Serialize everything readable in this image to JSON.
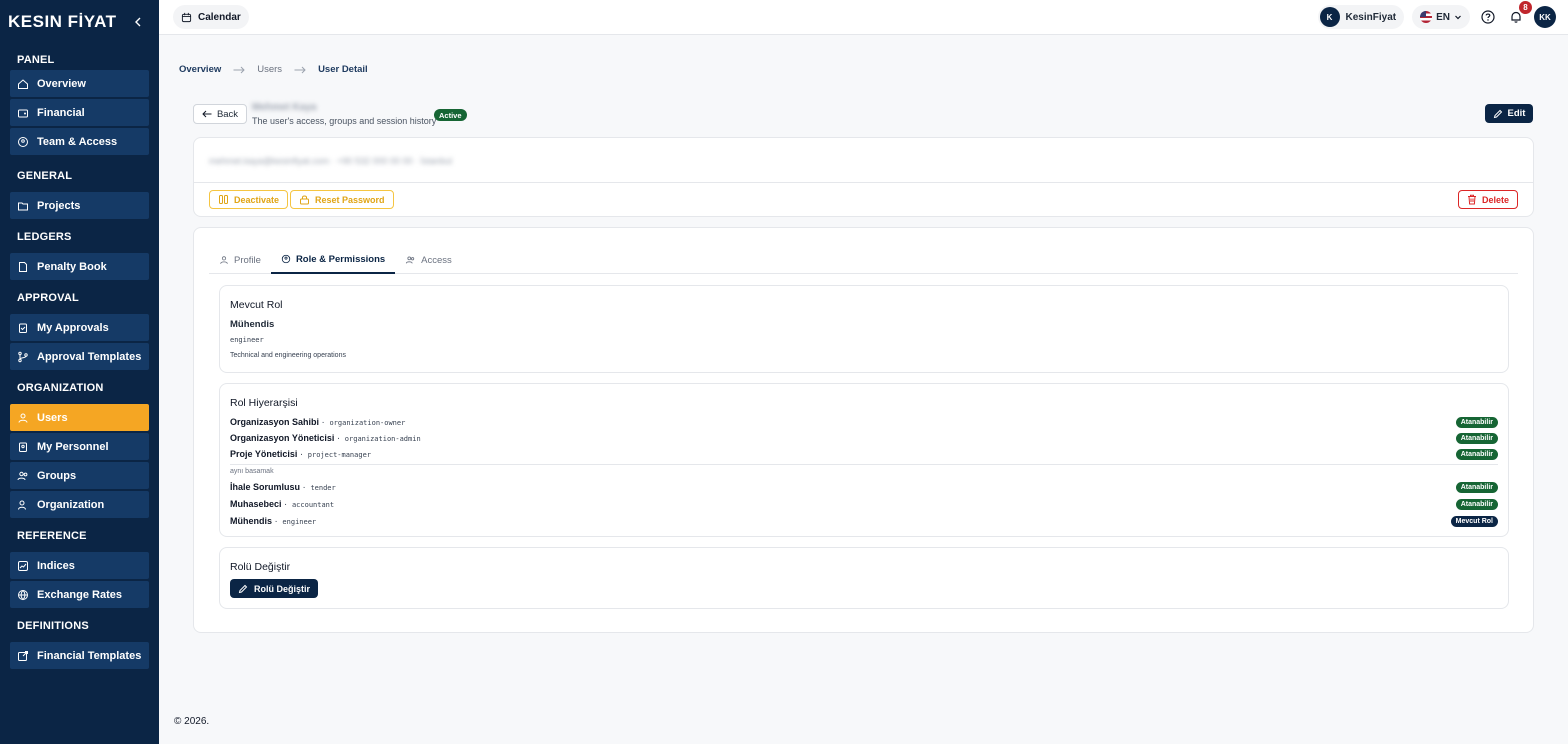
{
  "brand": {
    "logo": "KESIN FİYAT"
  },
  "sidebar": {
    "sections": [
      {
        "title": "PANEL",
        "items": [
          {
            "label": "Overview",
            "icon": "home-icon"
          },
          {
            "label": "Financial",
            "icon": "wallet-icon"
          },
          {
            "label": "Team & Access",
            "icon": "shield-user-icon"
          }
        ]
      },
      {
        "title": "GENERAL",
        "items": [
          {
            "label": "Projects",
            "icon": "folder-icon"
          }
        ]
      },
      {
        "title": "LEDGERS",
        "items": [
          {
            "label": "Penalty Book",
            "icon": "file-icon"
          }
        ]
      },
      {
        "title": "APPROVAL",
        "items": [
          {
            "label": "My Approvals",
            "icon": "clipboard-check-icon"
          },
          {
            "label": "Approval Templates",
            "icon": "git-branch-icon"
          }
        ]
      },
      {
        "title": "ORGANIZATION",
        "items": [
          {
            "label": "Users",
            "icon": "user-icon",
            "active": true
          },
          {
            "label": "My Personnel",
            "icon": "clipboard-user-icon"
          },
          {
            "label": "Groups",
            "icon": "users-icon"
          },
          {
            "label": "Organization",
            "icon": "user-cog-icon"
          }
        ]
      },
      {
        "title": "REFERENCE",
        "items": [
          {
            "label": "Indices",
            "icon": "trend-icon"
          },
          {
            "label": "Exchange Rates",
            "icon": "globe-icon"
          }
        ]
      },
      {
        "title": "DEFINITIONS",
        "items": [
          {
            "label": "Financial Templates",
            "icon": "external-file-icon"
          }
        ]
      }
    ]
  },
  "topbar": {
    "calendar_label": "Calendar",
    "org_initial": "K",
    "org_name": "KesinFiyat",
    "language": "EN",
    "notification_count": "8",
    "user_initials": "KK"
  },
  "breadcrumb": {
    "first": "Overview",
    "second": "Users",
    "current": "User Detail"
  },
  "header": {
    "back_label": "Back",
    "user_name": "Mehmet Kaya",
    "subtitle": "The user's access, groups and session history",
    "status": "Active",
    "edit_label": "Edit"
  },
  "info": {
    "blurred_line": "mehmet.kaya@kesinfiyat.com · +90 532 000 00 00 · İstanbul",
    "deactivate_label": "Deactivate",
    "reset_password_label": "Reset Password",
    "delete_label": "Delete"
  },
  "tabs": [
    {
      "label": "Profile",
      "icon": "user-icon"
    },
    {
      "label": "Role & Permissions",
      "icon": "shield-icon",
      "active": true
    },
    {
      "label": "Access",
      "icon": "users-icon"
    }
  ],
  "current_role": {
    "title": "Mevcut Rol",
    "name": "Mühendis",
    "code": "engineer",
    "description": "Technical and engineering operations"
  },
  "hierarchy": {
    "title": "Rol Hiyerarşisi",
    "same_level_note": "aynı basamak",
    "rows_above": [
      {
        "name": "Organizasyon Sahibi",
        "code": "· organization-owner",
        "badge": "Atanabilir"
      },
      {
        "name": "Organizasyon Yöneticisi",
        "code": "· organization-admin",
        "badge": "Atanabilir"
      },
      {
        "name": "Proje Yöneticisi",
        "code": "· project-manager",
        "badge": "Atanabilir"
      }
    ],
    "rows_same": [
      {
        "name": "İhale Sorumlusu",
        "code": "· tender",
        "badge": "Atanabilir"
      },
      {
        "name": "Muhasebeci",
        "code": "· accountant",
        "badge": "Atanabilir"
      },
      {
        "name": "Mühendis",
        "code": "· engineer",
        "badge": "Mevcut Rol"
      }
    ]
  },
  "change_role": {
    "title": "Rolü Değiştir",
    "button_label": "Rolü Değiştir"
  },
  "footer": {
    "text": "© 2026."
  }
}
